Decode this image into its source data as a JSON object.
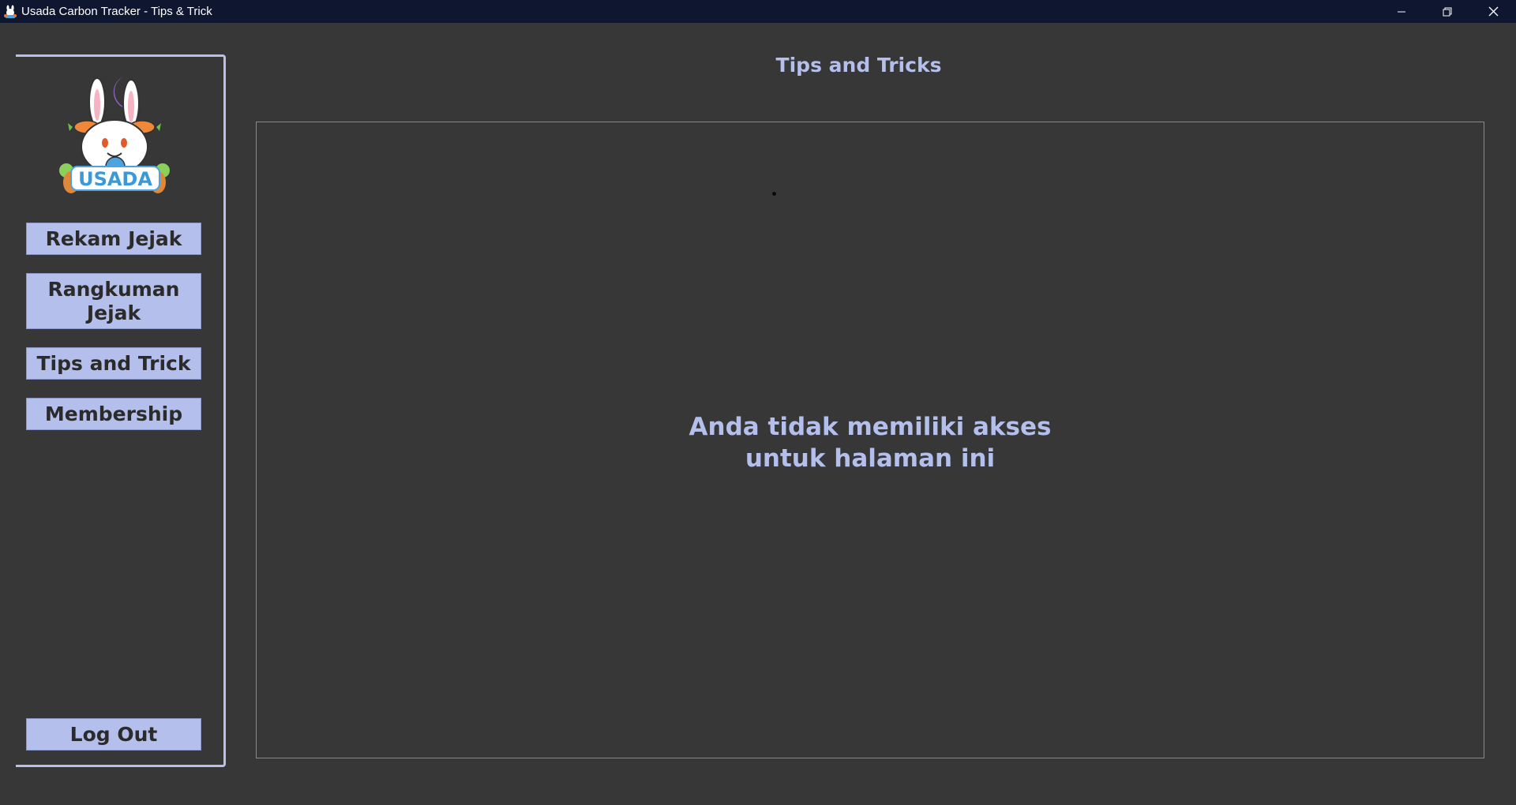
{
  "window": {
    "title": "Usada Carbon Tracker - Tips & Trick",
    "controls": [
      "minimize-icon",
      "restore-icon",
      "close-icon"
    ]
  },
  "sidebar": {
    "logo": {
      "text": "USADA",
      "icon": "usada-bunny-logo"
    },
    "nav_items": [
      {
        "label_line1": "Rekam Jejak",
        "label_line2": ""
      },
      {
        "label_line1": "Rangkuman",
        "label_line2": "Jejak"
      },
      {
        "label_line1": "Tips and Trick",
        "label_line2": ""
      },
      {
        "label_line1": "Membership",
        "label_line2": ""
      }
    ],
    "logout_label": "Log Out"
  },
  "main": {
    "title": "Tips and Tricks",
    "message_line1": "Anda tidak memiliki akses",
    "message_line2": "untuk halaman ini"
  },
  "colors": {
    "background": "#373737",
    "titlebar": "#0e1630",
    "accent": "#b4bfeb",
    "button_text": "#2b2b2b"
  }
}
